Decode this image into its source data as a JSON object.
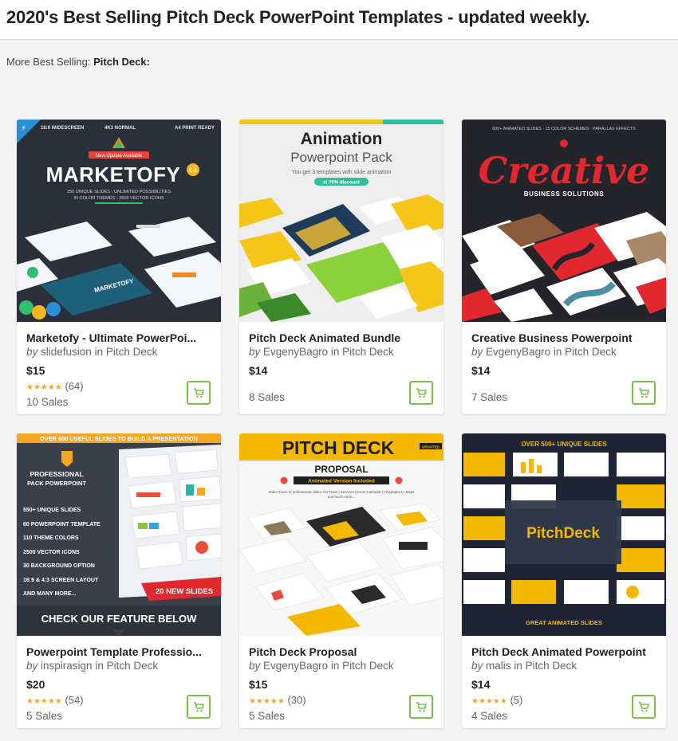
{
  "header": {
    "title": "2020's Best Selling Pitch Deck PowerPoint Templates - updated weekly."
  },
  "subhead": {
    "label": "More Best Selling:",
    "category": "Pitch Deck:"
  },
  "common": {
    "by": "by",
    "in": "in"
  },
  "colors": {
    "cart_green": "#7bbf4a",
    "star": "#f5a623"
  },
  "items": [
    {
      "name": "Marketofy - Ultimate PowerPoi...",
      "author": "slidefusion",
      "category": "Pitch Deck",
      "price": "$15",
      "stars": "★★★★★",
      "reviews": "(64)",
      "sales": "10 Sales",
      "thumb": {
        "top_labels": [
          "16:9 WIDESCREEN",
          "4K3 NORMAL",
          "A4 PRINT READY"
        ],
        "badge": "New Update Available",
        "title": "MARKETOFY",
        "version": "1.0",
        "line1": "250 UNIQUE SLIDES - UNLIMITED POSSIBILITIES",
        "line2": "IN COLOR THEMES - 2500 VECTOR ICONS",
        "slide_text": "MARKETOFY"
      }
    },
    {
      "name": "Pitch Deck Animated Bundle",
      "author": "EvgenyBagro",
      "category": "Pitch Deck",
      "price": "$14",
      "stars": "",
      "reviews": "",
      "sales": "8 Sales",
      "thumb": {
        "title": "Animation",
        "subtitle": "Powerpoint Pack",
        "line1": "You get 3 templates with slide animation",
        "badge": "at 70% discount"
      }
    },
    {
      "name": "Creative Business Powerpoint",
      "author": "EvgenyBagro",
      "category": "Pitch Deck",
      "price": "$14",
      "stars": "",
      "reviews": "",
      "sales": "7 Sales",
      "thumb": {
        "top_line": "600+ ANIMATED SLIDES · 15 COLOR SCHEMES · PARALLAX EFFECTS",
        "title": "Creative",
        "subtitle": "BUSINESS SOLUTIONS"
      }
    },
    {
      "name": "Powerpoint Template Professio...",
      "author": "inspirasign",
      "category": "Pitch Deck",
      "price": "$20",
      "stars": "★★★★★",
      "reviews": "(54)",
      "sales": "5 Sales",
      "thumb": {
        "top_line": "OVER 600 USEFUL SLIDES TO BUILD A PRESENTATION",
        "title1": "PROFESSIONAL",
        "title2": "PACK POWERPOINT",
        "features": [
          "550+ UNIQUE SLIDES",
          "60 POWERPOINT TEMPLATE",
          "110 THEME COLORS",
          "2500 VECTOR ICONS",
          "30 BACKGROUND OPTION",
          "16:9 & 4:3 SCREEN LAYOUT",
          "AND MANY MORE..."
        ],
        "ribbon": "20 NEW SLIDES",
        "bottom": "CHECK OUR FEATURE BELOW"
      }
    },
    {
      "name": "Pitch Deck Proposal",
      "author": "EvgenyBagro",
      "category": "Pitch Deck",
      "price": "$15",
      "stars": "★★★★★",
      "reviews": "(30)",
      "sales": "5 Sales",
      "thumb": {
        "title": "PITCH DECK",
        "tag": "UPDATED",
        "subtitle": "PROPOSAL",
        "badge": "Animated Version Included",
        "line1": "Wide choice of professional slides: the Team | Services | Event Calendar | Infographics | Maps",
        "line2": "and much more..."
      }
    },
    {
      "name": "Pitch Deck Animated Powerpoint",
      "author": "malis",
      "category": "Pitch Deck",
      "price": "$14",
      "stars": "★★★★★",
      "reviews": "(5)",
      "sales": "4 Sales",
      "thumb": {
        "top_line": "OVER 500+ UNIQUE SLIDES",
        "title": "PitchDeck",
        "bottom": "GREAT ANIMATED SLIDES"
      }
    }
  ]
}
